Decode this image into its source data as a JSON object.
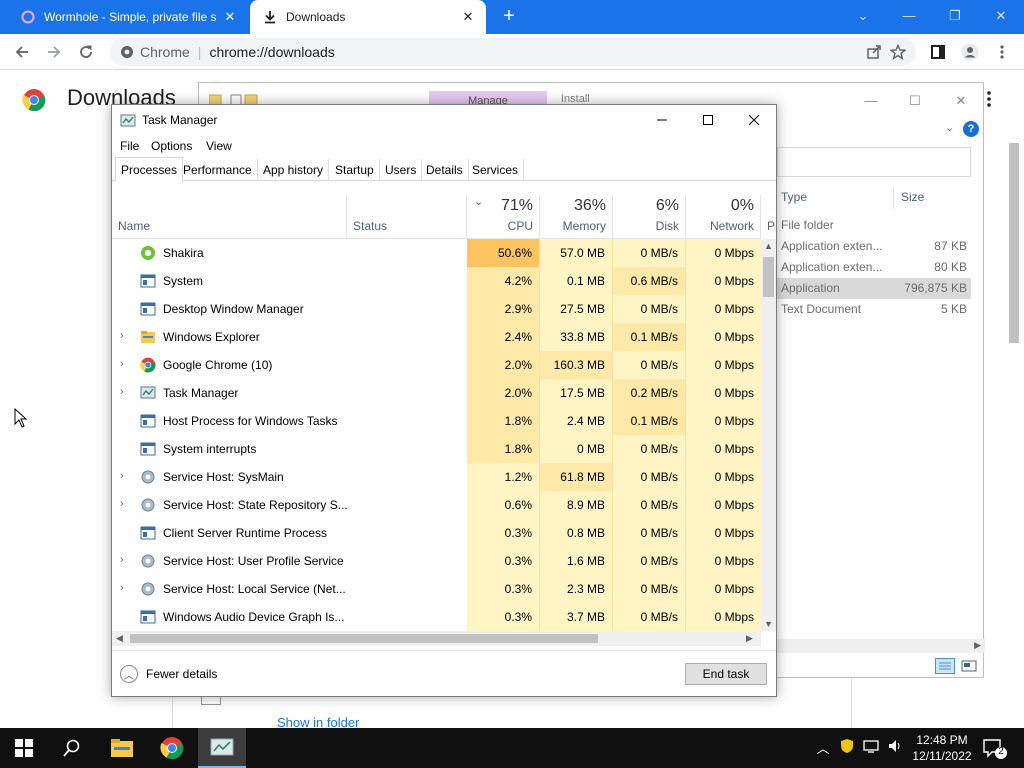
{
  "browser": {
    "tabs": [
      {
        "title": "Wormhole - Simple, private file s",
        "icon": "wormhole-icon"
      },
      {
        "title": "Downloads",
        "icon": "download-icon"
      }
    ],
    "address": {
      "site": "Chrome",
      "url": "chrome://downloads"
    },
    "accent": "#1a73e8"
  },
  "downloads_page": {
    "title": "Downloads",
    "show_in_folder": "Show in folder"
  },
  "explorer": {
    "manage_label": "Manage",
    "install_label": "Install",
    "columns": {
      "type": "Type",
      "size": "Size"
    },
    "rows": [
      {
        "type": "File folder",
        "size": ""
      },
      {
        "type": "Application exten...",
        "size": "87 KB"
      },
      {
        "type": "Application exten...",
        "size": "80 KB"
      },
      {
        "type": "Application",
        "size": "796,875 KB",
        "selected": true
      },
      {
        "type": "Text Document",
        "size": "5 KB"
      }
    ]
  },
  "task_manager": {
    "title": "Task Manager",
    "menu": [
      "File",
      "Options",
      "View"
    ],
    "tabs": [
      "Processes",
      "Performance",
      "App history",
      "Startup",
      "Users",
      "Details",
      "Services"
    ],
    "active_tab": "Processes",
    "columns": {
      "name": "Name",
      "status": "Status",
      "cpu": {
        "pct": "71%",
        "label": "CPU"
      },
      "memory": {
        "pct": "36%",
        "label": "Memory"
      },
      "disk": {
        "pct": "6%",
        "label": "Disk"
      },
      "network": {
        "pct": "0%",
        "label": "Network"
      },
      "power": "P"
    },
    "processes": [
      {
        "name": "Shakira",
        "cpu": "50.6%",
        "memory": "57.0 MB",
        "disk": "0 MB/s",
        "network": "0 Mbps",
        "expandable": false,
        "icon": "shakira-icon"
      },
      {
        "name": "System",
        "cpu": "4.2%",
        "memory": "0.1 MB",
        "disk": "0.6 MB/s",
        "network": "0 Mbps",
        "expandable": false,
        "icon": "window-icon"
      },
      {
        "name": "Desktop Window Manager",
        "cpu": "2.9%",
        "memory": "27.5 MB",
        "disk": "0 MB/s",
        "network": "0 Mbps",
        "expandable": false,
        "icon": "window-icon"
      },
      {
        "name": "Windows Explorer",
        "cpu": "2.4%",
        "memory": "33.8 MB",
        "disk": "0.1 MB/s",
        "network": "0 Mbps",
        "expandable": true,
        "icon": "folder-icon"
      },
      {
        "name": "Google Chrome (10)",
        "cpu": "2.0%",
        "memory": "160.3 MB",
        "disk": "0 MB/s",
        "network": "0 Mbps",
        "expandable": true,
        "icon": "chrome-icon"
      },
      {
        "name": "Task Manager",
        "cpu": "2.0%",
        "memory": "17.5 MB",
        "disk": "0.2 MB/s",
        "network": "0 Mbps",
        "expandable": true,
        "icon": "taskmanager-icon"
      },
      {
        "name": "Host Process for Windows Tasks",
        "cpu": "1.8%",
        "memory": "2.4 MB",
        "disk": "0.1 MB/s",
        "network": "0 Mbps",
        "expandable": false,
        "icon": "window-icon"
      },
      {
        "name": "System interrupts",
        "cpu": "1.8%",
        "memory": "0 MB",
        "disk": "0 MB/s",
        "network": "0 Mbps",
        "expandable": false,
        "icon": "window-icon"
      },
      {
        "name": "Service Host: SysMain",
        "cpu": "1.2%",
        "memory": "61.8 MB",
        "disk": "0 MB/s",
        "network": "0 Mbps",
        "expandable": true,
        "icon": "gear-icon"
      },
      {
        "name": "Service Host: State Repository S...",
        "cpu": "0.6%",
        "memory": "8.9 MB",
        "disk": "0 MB/s",
        "network": "0 Mbps",
        "expandable": true,
        "icon": "gear-icon"
      },
      {
        "name": "Client Server Runtime Process",
        "cpu": "0.3%",
        "memory": "0.8 MB",
        "disk": "0 MB/s",
        "network": "0 Mbps",
        "expandable": false,
        "icon": "window-icon"
      },
      {
        "name": "Service Host: User Profile Service",
        "cpu": "0.3%",
        "memory": "1.6 MB",
        "disk": "0 MB/s",
        "network": "0 Mbps",
        "expandable": true,
        "icon": "gear-icon"
      },
      {
        "name": "Service Host: Local Service (Net...",
        "cpu": "0.3%",
        "memory": "2.3 MB",
        "disk": "0 MB/s",
        "network": "0 Mbps",
        "expandable": true,
        "icon": "gear-icon"
      },
      {
        "name": "Windows Audio Device Graph Is...",
        "cpu": "0.3%",
        "memory": "3.7 MB",
        "disk": "0 MB/s",
        "network": "0 Mbps",
        "expandable": false,
        "icon": "window-icon"
      }
    ],
    "fewer_details": "Fewer details",
    "end_task": "End task"
  },
  "taskbar": {
    "apps": [
      "file-explorer-icon",
      "chrome-icon",
      "task-manager-icon"
    ],
    "time": "12:48 PM",
    "date": "12/11/2022",
    "notifications": "2"
  }
}
